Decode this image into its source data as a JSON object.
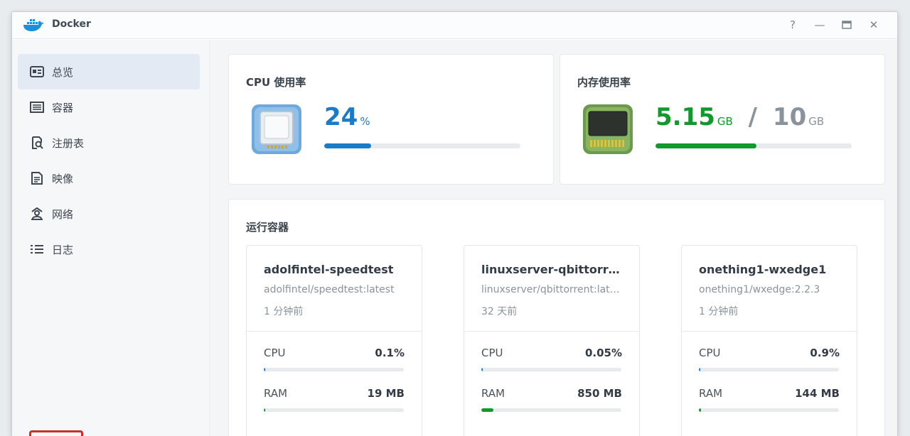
{
  "window": {
    "title": "Docker"
  },
  "titlebar_buttons": {
    "help": "?",
    "minimize": "—",
    "maximize": "▭",
    "close": "✕"
  },
  "sidebar": {
    "items": [
      {
        "label": "总览",
        "icon": "overview-icon",
        "active": true
      },
      {
        "label": "容器",
        "icon": "container-icon"
      },
      {
        "label": "注册表",
        "icon": "registry-icon"
      },
      {
        "label": "映像",
        "icon": "image-icon"
      },
      {
        "label": "网络",
        "icon": "network-icon"
      },
      {
        "label": "日志",
        "icon": "log-icon"
      }
    ]
  },
  "cpu": {
    "title": "CPU 使用率",
    "value": "24",
    "unit": "%",
    "percent": 24,
    "color": "#1a7cc8"
  },
  "memory": {
    "title": "内存使用率",
    "used": "5.15",
    "used_unit": "GB",
    "separator": "/",
    "total": "10",
    "total_unit": "GB",
    "percent": 51.5,
    "color": "#12992b"
  },
  "containers": {
    "title": "运行容器",
    "items": [
      {
        "name": "adolfintel-speedtest",
        "image": "adolfintel/speedtest:latest",
        "time": "1 分钟前",
        "cpu_label": "CPU",
        "cpu": "0.1%",
        "cpu_pct": 0.1,
        "ram_label": "RAM",
        "ram": "19 MB",
        "ram_pct": 1
      },
      {
        "name": "linuxserver-qbittorrent",
        "image": "linuxserver/qbittorrent:latest",
        "time": "32 天前",
        "cpu_label": "CPU",
        "cpu": "0.05%",
        "cpu_pct": 0.05,
        "ram_label": "RAM",
        "ram": "850 MB",
        "ram_pct": 8.5
      },
      {
        "name": "onething1-wxedge1",
        "image": "onething1/wxedge:2.2.3",
        "time": "1 分钟前",
        "cpu_label": "CPU",
        "cpu": "0.9%",
        "cpu_pct": 0.9,
        "ram_label": "RAM",
        "ram": "144 MB",
        "ram_pct": 1.5
      }
    ]
  },
  "colors": {
    "cpu_bar": "#1a7cc8",
    "ram_bar": "#12992b",
    "mini_bar": "#1a7cc8",
    "mini_ram": "#12992b"
  }
}
